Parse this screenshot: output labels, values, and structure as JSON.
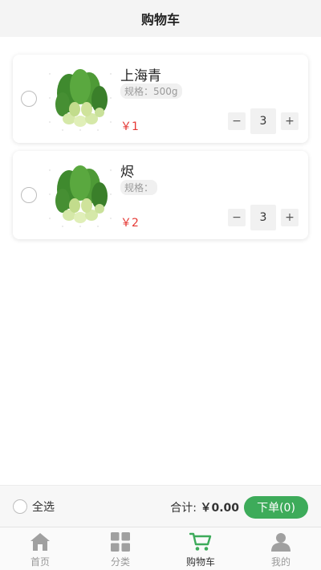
{
  "header": {
    "title": "购物车"
  },
  "cart": {
    "items": [
      {
        "name": "上海青",
        "spec": "规格：500g",
        "price": "￥1",
        "qty": "3",
        "minus": "−",
        "plus": "+"
      },
      {
        "name": "烬",
        "spec": "规格：",
        "price": "￥2",
        "qty": "3",
        "minus": "−",
        "plus": "+"
      }
    ]
  },
  "footer": {
    "select_all": "全选",
    "total_label": "合计:",
    "total_value": "￥0.00",
    "order_button": "下单(0)"
  },
  "tabs": [
    {
      "label": "首页",
      "icon": "home-icon"
    },
    {
      "label": "分类",
      "icon": "grid-icon"
    },
    {
      "label": "购物车",
      "icon": "cart-icon",
      "active": true
    },
    {
      "label": "我的",
      "icon": "user-icon"
    }
  ],
  "colors": {
    "accent": "#3dab5a",
    "price": "#e53935",
    "icon_gray": "#a0a0a0"
  }
}
